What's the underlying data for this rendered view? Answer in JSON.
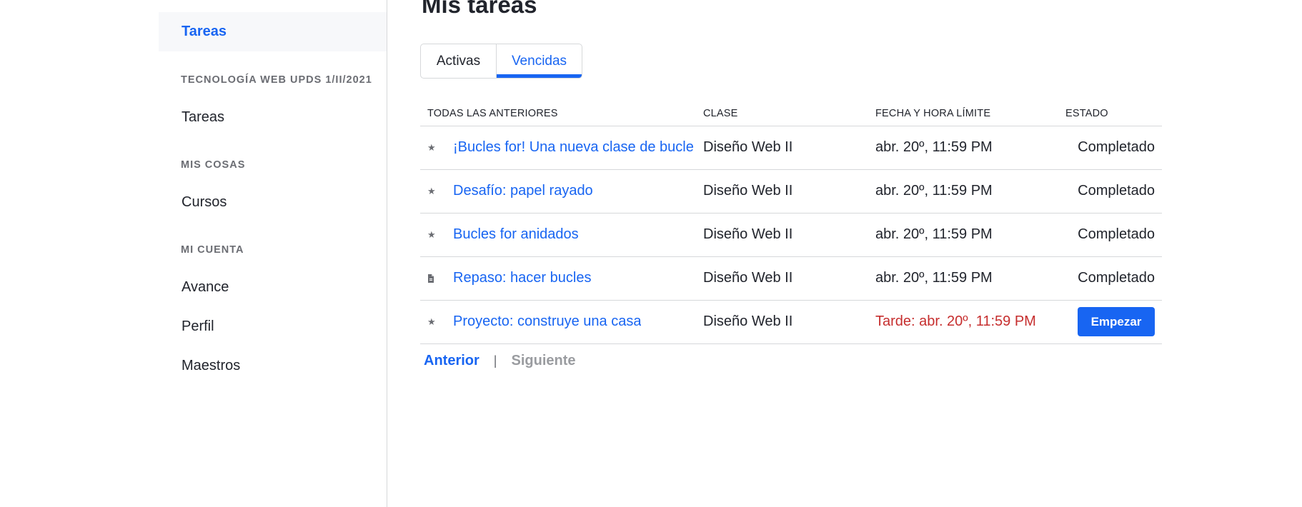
{
  "sidebar": {
    "top_link": "Tareas",
    "section1_heading": "TECNOLOGÍA WEB UPDS 1/II/2021",
    "section1_link": "Tareas",
    "section2_heading": "MIS COSAS",
    "section2_link": "Cursos",
    "section3_heading": "MI CUENTA",
    "section3_links": [
      "Avance",
      "Perfil",
      "Maestros"
    ]
  },
  "page": {
    "title": "Mis tareas"
  },
  "tabs": {
    "active_label": "Activas",
    "overdue_label": "Vencidas",
    "selected": "Vencidas"
  },
  "table": {
    "headers": [
      "TODAS LAS ANTERIORES",
      "CLASE",
      "FECHA Y HORA LÍMITE",
      "ESTADO"
    ],
    "rows": [
      {
        "icon": "star-icon",
        "title": "¡Bucles for! Una nueva clase de bucle",
        "class": "Diseño Web II",
        "due": "abr. 20º, 11:59 PM",
        "status": "Completado"
      },
      {
        "icon": "star-icon",
        "title": "Desafío: papel rayado",
        "class": "Diseño Web II",
        "due": "abr. 20º, 11:59 PM",
        "status": "Completado"
      },
      {
        "icon": "star-icon",
        "title": "Bucles for anidados",
        "class": "Diseño Web II",
        "due": "abr. 20º, 11:59 PM",
        "status": "Completado"
      },
      {
        "icon": "document-icon",
        "title": "Repaso: hacer bucles",
        "class": "Diseño Web II",
        "due": "abr. 20º, 11:59 PM",
        "status": "Completado"
      },
      {
        "icon": "star-icon",
        "title": "Proyecto: construye una casa",
        "class": "Diseño Web II",
        "due": "Tarde: abr. 20º, 11:59 PM",
        "status": "Empezar"
      }
    ]
  },
  "pager": {
    "prev": "Anterior",
    "separator": "|",
    "next": "Siguiente"
  },
  "colors": {
    "accent": "#1865f2",
    "late": "#c62e2e",
    "text": "#21242c",
    "muted": "#6b6d73"
  }
}
